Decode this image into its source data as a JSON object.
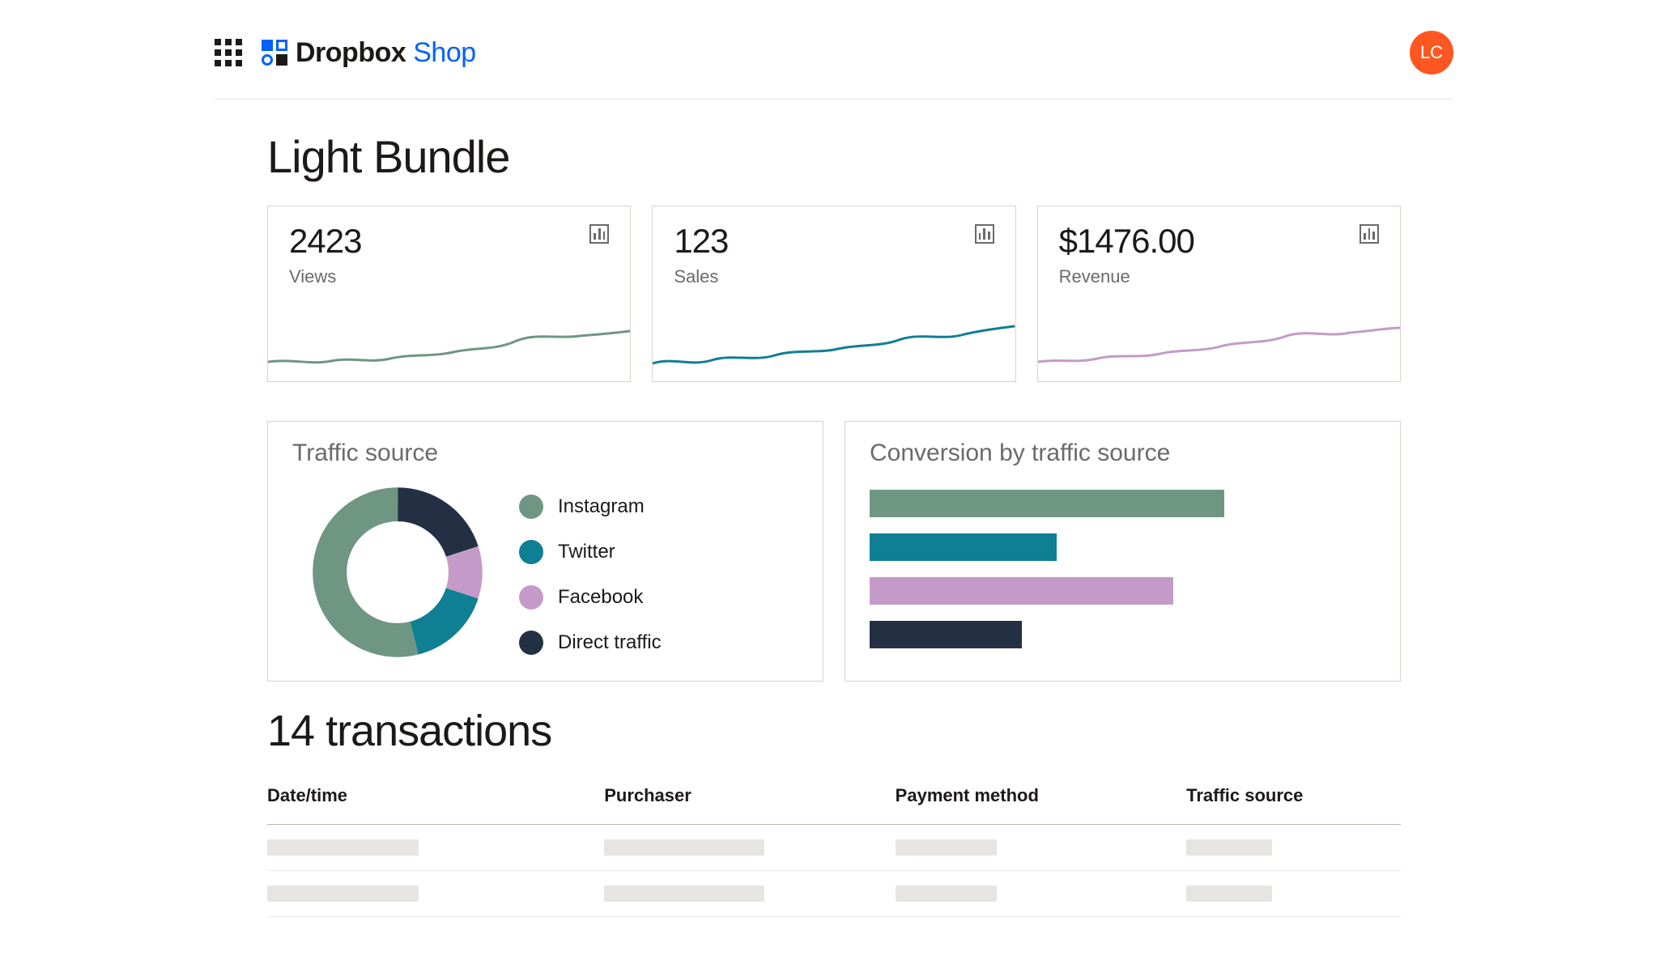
{
  "header": {
    "brand_main": "Dropbox",
    "brand_sub": "Shop",
    "avatar_initials": "LC"
  },
  "page": {
    "title": "Light Bundle"
  },
  "stats": {
    "views": {
      "value": "2423",
      "label": "Views",
      "color": "#6f9683"
    },
    "sales": {
      "value": "123",
      "label": "Sales",
      "color": "#0f7f93"
    },
    "revenue": {
      "value": "$1476.00",
      "label": "Revenue",
      "color": "#c49bc8"
    }
  },
  "traffic_panel": {
    "title": "Traffic source"
  },
  "conversion_panel": {
    "title": "Conversion by traffic source"
  },
  "legend": {
    "instagram": "Instagram",
    "twitter": "Twitter",
    "facebook": "Facebook",
    "direct": "Direct traffic"
  },
  "colors": {
    "instagram": "#6f9683",
    "twitter": "#0f7f93",
    "facebook": "#c49bc8",
    "direct": "#233044"
  },
  "transactions": {
    "title": "14 transactions",
    "columns": {
      "datetime": "Date/time",
      "purchaser": "Purchaser",
      "payment": "Payment method",
      "source": "Traffic source"
    }
  },
  "chart_data": [
    {
      "type": "pie",
      "title": "Traffic source",
      "series": [
        {
          "name": "Instagram",
          "value": 54
        },
        {
          "name": "Twitter",
          "value": 16
        },
        {
          "name": "Facebook",
          "value": 10
        },
        {
          "name": "Direct traffic",
          "value": 20
        }
      ]
    },
    {
      "type": "bar",
      "title": "Conversion by traffic source",
      "categories": [
        "Instagram",
        "Twitter",
        "Facebook",
        "Direct traffic"
      ],
      "values_pct": [
        70,
        37,
        60,
        30
      ]
    },
    {
      "type": "line",
      "title": "Views sparkline",
      "values": [
        40,
        42,
        38,
        42,
        40,
        45,
        50,
        48,
        55,
        62,
        58,
        66,
        65,
        68
      ]
    },
    {
      "type": "line",
      "title": "Sales sparkline",
      "values": [
        38,
        42,
        36,
        44,
        42,
        48,
        50,
        54,
        52,
        60,
        58,
        66,
        68,
        72
      ]
    },
    {
      "type": "line",
      "title": "Revenue sparkline",
      "values": [
        38,
        42,
        40,
        46,
        44,
        50,
        48,
        56,
        60,
        58,
        66,
        70,
        68,
        72
      ]
    }
  ]
}
